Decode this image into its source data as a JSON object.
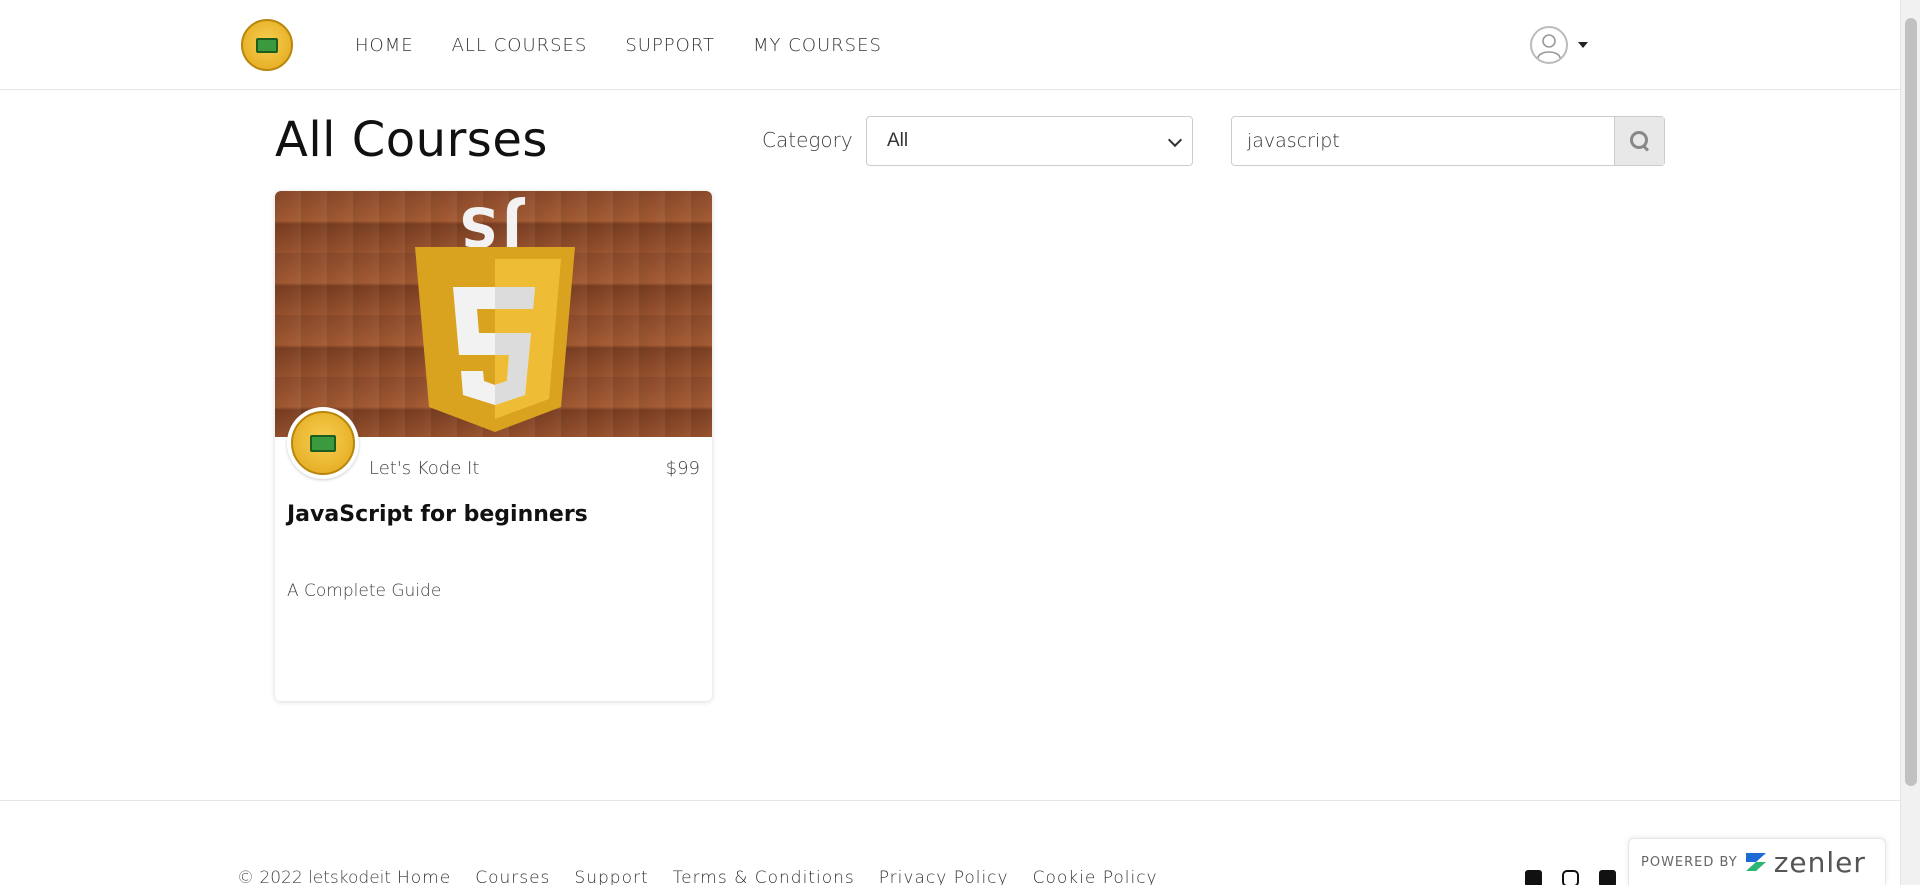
{
  "header": {
    "logo_icon": "lets-kode-it-logo",
    "nav": [
      {
        "label": "HOME"
      },
      {
        "label": "ALL COURSES"
      },
      {
        "label": "SUPPORT"
      },
      {
        "label": "MY COURSES"
      }
    ],
    "avatar_icon": "user-avatar-icon",
    "caret_icon": "caret-down-icon"
  },
  "main": {
    "title": "All Courses",
    "category_label": "Category",
    "category_selected": "All",
    "search_value": "javascript",
    "search_icon": "search-icon"
  },
  "courses": [
    {
      "author": "Let's Kode It",
      "price": "$99",
      "title": "JavaScript for beginners",
      "subtitle": "A Complete Guide",
      "image_badge": "JS"
    }
  ],
  "footer": {
    "copyright": "© 2022 letskodeit",
    "links": [
      {
        "label": "Home"
      },
      {
        "label": "Courses"
      },
      {
        "label": "Support"
      },
      {
        "label": "Terms & Conditions"
      },
      {
        "label": "Privacy Policy"
      },
      {
        "label": "Cookie Policy"
      }
    ],
    "social": [
      "facebook-icon",
      "instagram-icon",
      "twitter-icon"
    ],
    "powered_by": "POWERED BY",
    "powered_brand": "zenler"
  },
  "colors": {
    "js_shield_dark": "#d9a21f",
    "js_shield_light": "#efbd35",
    "wood": "#9a5430",
    "search_button_bg": "#e8e8e8",
    "zenler_blue": "#1f6bd6",
    "zenler_green": "#2bb673"
  }
}
